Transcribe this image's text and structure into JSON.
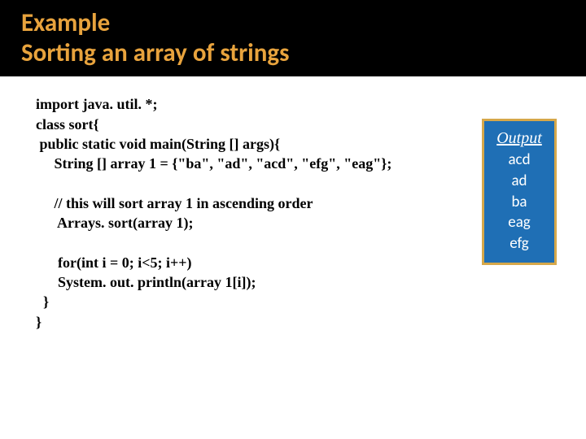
{
  "title": {
    "line1": "Example",
    "line2": "Sorting an array of strings"
  },
  "code": {
    "l1": "import java. util. *;",
    "l2": "class sort{",
    "l3": " public static void main(String [] args){",
    "l4": "     String [] array 1 = {\"ba\", \"ad\", \"acd\", \"efg\", \"eag\"};",
    "l5": "",
    "l6": "     // this will sort array 1 in ascending order",
    "l7": "      Arrays. sort(array 1);",
    "l8": "",
    "l9": "      for(int i = 0; i<5; i++)",
    "l10": "      System. out. println(array 1[i]);",
    "l11": "  }",
    "l12": "}"
  },
  "output": {
    "title": "Output",
    "r1": "acd",
    "r2": "ad",
    "r3": "ba",
    "r4": "eag",
    "r5": "efg"
  }
}
